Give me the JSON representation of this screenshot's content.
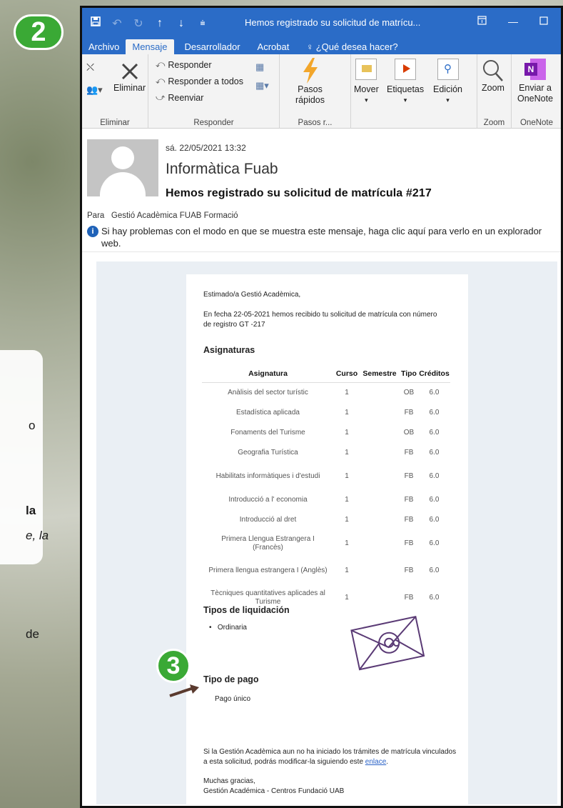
{
  "window_title": "Hemos registrado su solicitud de matrícu...",
  "steps": {
    "badge_2": "2",
    "badge_3": "3"
  },
  "side_fragments": {
    "f1": "o",
    "f2": "la",
    "f3": "e, la",
    "f4": "de"
  },
  "menu": [
    "Archivo",
    "Mensaje",
    "Desarrollador",
    "Acrobat",
    "¿Qué desea hacer?"
  ],
  "ribbon": {
    "eliminar_btn": "Eliminar",
    "responder": "Responder",
    "responder_todos": "Responder a todos",
    "reenviar": "Reenviar",
    "pasos_line1": "Pasos",
    "pasos_line2": "rápidos",
    "mover": "Mover",
    "etiquetas": "Etiquetas",
    "edicion": "Edición",
    "zoom": "Zoom",
    "enviar_line1": "Enviar a",
    "enviar_line2": "OneNote",
    "groups": [
      "Eliminar",
      "Responder",
      "Pasos r...",
      "Zoom",
      "OneNote"
    ]
  },
  "header": {
    "date": "sá. 22/05/2021 13:32",
    "from": "Informàtica Fuab",
    "subject": "Hemos registrado su solicitud de matrícula #217",
    "to_label": "Para",
    "to_value": "Gestió Acadèmica FUAB Formació",
    "info": "Si hay problemas con el modo en que se muestra este mensaje, haga clic aquí para verlo en un explorador web."
  },
  "email": {
    "greeting": "Estimado/a Gestió Acadèmica,",
    "intro": "En fecha 22-05-2021 hemos recibido tu solicitud de matrícula con número de registro GT -217",
    "asignaturas_title": "Asignaturas",
    "table_headers": [
      "Asignatura",
      "Curso",
      "Semestre",
      "Tipo",
      "Créditos"
    ],
    "rows": [
      [
        "Anàlisis del sector turístic",
        "1",
        "",
        "OB",
        "6.0"
      ],
      [
        "Estadística aplicada",
        "1",
        "",
        "FB",
        "6.0"
      ],
      [
        "Fonaments del Turisme",
        "1",
        "",
        "OB",
        "6.0"
      ],
      [
        "Geografia Turística",
        "1",
        "",
        "FB",
        "6.0"
      ],
      [
        "Habilitats informàtiques i d'estudi",
        "1",
        "",
        "FB",
        "6.0"
      ],
      [
        "Introducció a l' economia",
        "1",
        "",
        "FB",
        "6.0"
      ],
      [
        "Introducció al dret",
        "1",
        "",
        "FB",
        "6.0"
      ],
      [
        "Primera Llengua Estrangera I (Francès)",
        "1",
        "",
        "FB",
        "6.0"
      ],
      [
        "Primera llengua estrangera I (Anglès)",
        "1",
        "",
        "FB",
        "6.0"
      ],
      [
        "Tècniques quantitatives aplicades al Turisme",
        "1",
        "",
        "FB",
        "6.0"
      ]
    ],
    "liquidacion_title": "Tipos de liquidación",
    "liquidacion_item": "Ordinaria",
    "pago_title": "Tipo de pago",
    "pago_value": "Pago único",
    "footer_text": "Si la Gestión Acadèmica aun no ha iniciado los trámites de matrícula vinculados a esta solicitud, podrás modificar-la siguiendo este",
    "link_text": "enlace",
    "thanks": "Muchas gracias,",
    "signature": "Gestión Académica - Centros Fundació UAB"
  },
  "colors": {
    "titlebar": "#2b6cc7",
    "badge": "#3aa935",
    "link": "#2a62c7"
  }
}
